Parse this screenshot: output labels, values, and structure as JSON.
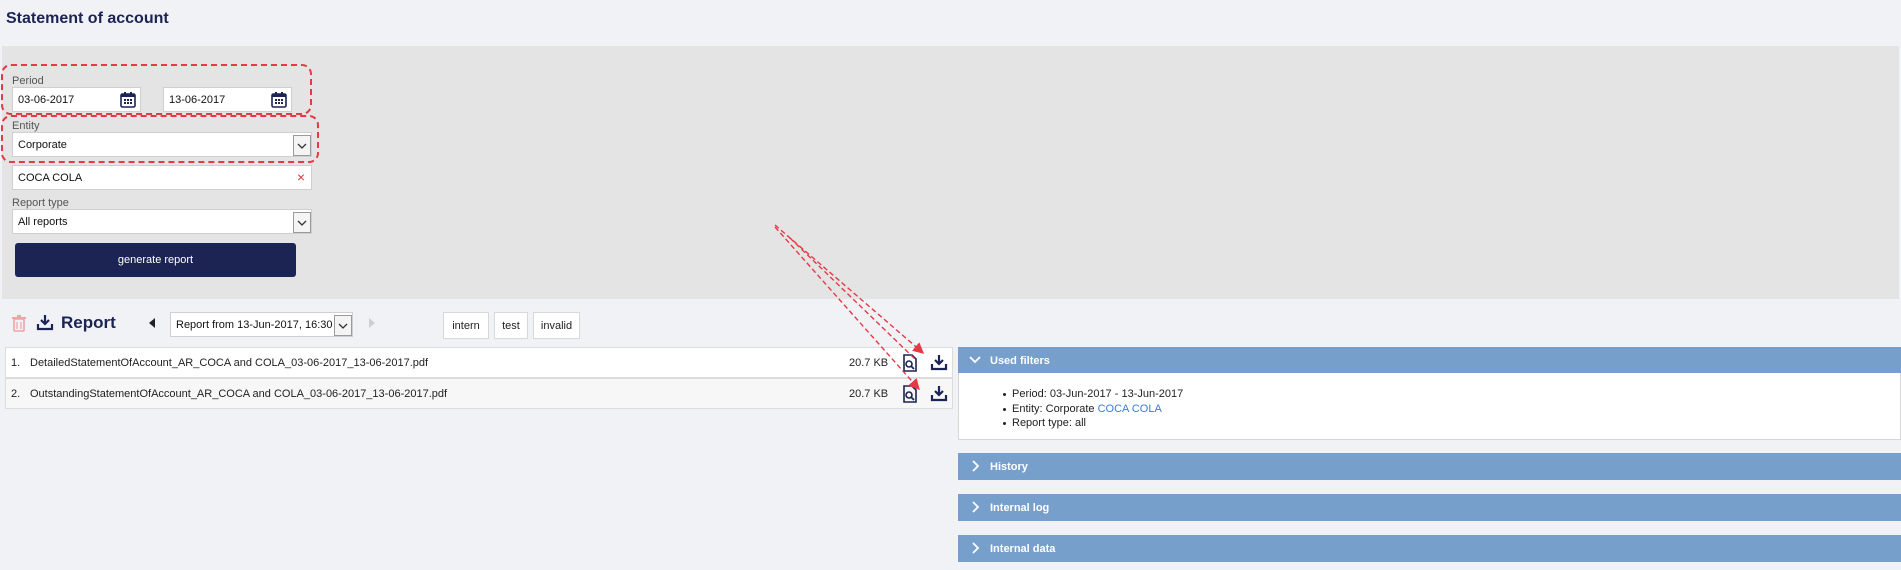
{
  "page": {
    "title": "Statement of account"
  },
  "filters": {
    "period_label": "Period",
    "date_from": "03-06-2017",
    "date_to": "13-06-2017",
    "entity_label": "Entity",
    "entity_value": "Corporate",
    "entity_search_value": "COCA COLA",
    "clear_icon": "×",
    "report_type_label": "Report type",
    "report_type_value": "All reports",
    "generate_label": "generate report"
  },
  "report": {
    "title": "Report",
    "selected_report": "Report from 13-Jun-2017, 16:30",
    "tags": [
      "intern",
      "test",
      "invalid"
    ],
    "files": [
      {
        "index": "1.",
        "name": "DetailedStatementOfAccount_AR_COCA and COLA_03-06-2017_13-06-2017.pdf",
        "size": "20.7 KB"
      },
      {
        "index": "2.",
        "name": "OutstandingStatementOfAccount_AR_COCA and COLA_03-06-2017_13-06-2017.pdf",
        "size": "20.7 KB"
      }
    ]
  },
  "panels": {
    "used_filters": {
      "title": "Used filters",
      "period_text": "Period: 03-Jun-2017 - 13-Jun-2017",
      "entity_prefix": "Entity: Corporate",
      "entity_link": "COCA COLA",
      "report_type_text": "Report type: all"
    },
    "history": "History",
    "internal_log": "Internal log",
    "internal_data": "Internal data"
  },
  "colors": {
    "navy": "#1b2453",
    "panel_blue": "#779fcc",
    "annotation_red": "#e53946",
    "link_blue": "#3a7bd5"
  }
}
